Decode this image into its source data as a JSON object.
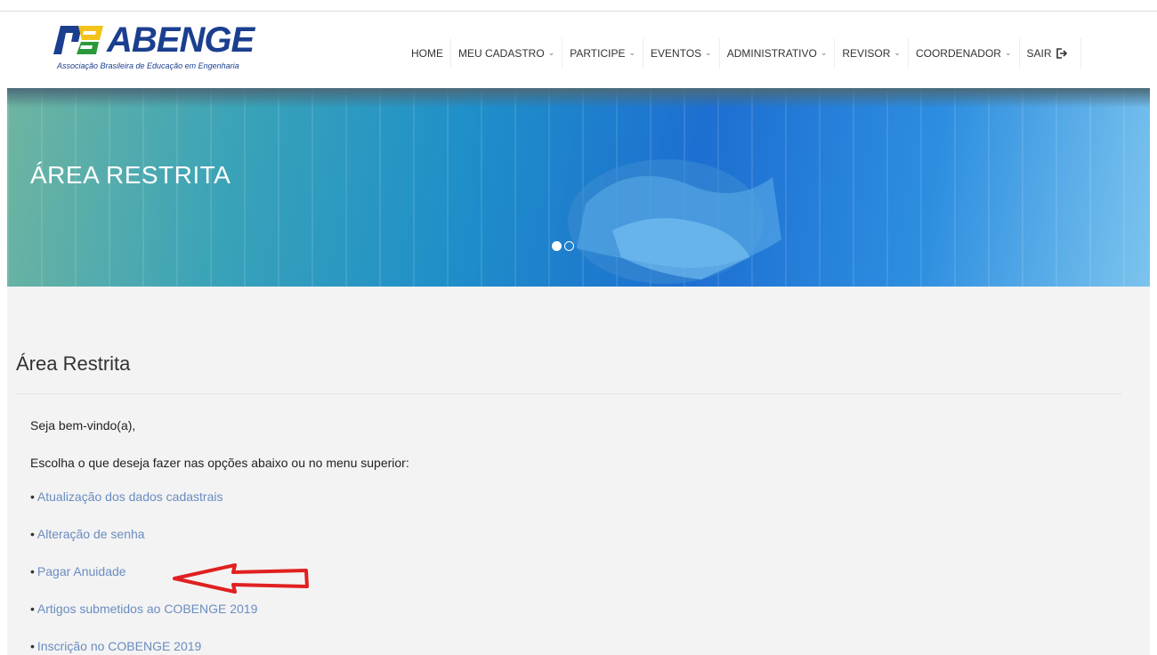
{
  "brand": {
    "name": "ABENGE",
    "subtitle": "Associação Brasileira de Educação em Engenharia"
  },
  "nav": {
    "items": [
      {
        "label": "HOME",
        "dropdown": false
      },
      {
        "label": "MEU CADASTRO",
        "dropdown": true
      },
      {
        "label": "PARTICIPE",
        "dropdown": true
      },
      {
        "label": "EVENTOS",
        "dropdown": true
      },
      {
        "label": "ADMINISTRATIVO",
        "dropdown": true
      },
      {
        "label": "REVISOR",
        "dropdown": true
      },
      {
        "label": "COORDENADOR",
        "dropdown": true
      },
      {
        "label": "SAIR",
        "dropdown": false,
        "icon": "sign-out-icon"
      }
    ]
  },
  "banner": {
    "title": "ÁREA RESTRITA",
    "slides": 2,
    "active_slide": 1
  },
  "main": {
    "title": "Área Restrita",
    "welcome": "Seja bem-vindo(a),",
    "instruction": "Escolha o que deseja fazer nas opções abaixo ou no menu superior:",
    "links": [
      "Atualização dos dados cadastrais",
      "Alteração de senha",
      "Pagar Anuidade",
      "Artigos submetidos ao COBENGE 2019",
      "Inscrição no COBENGE 2019"
    ]
  },
  "colors": {
    "brand": "#1b3f8f",
    "link": "#6a8cc0",
    "arrow": "#e02020",
    "content_bg": "#f3f3f3"
  }
}
